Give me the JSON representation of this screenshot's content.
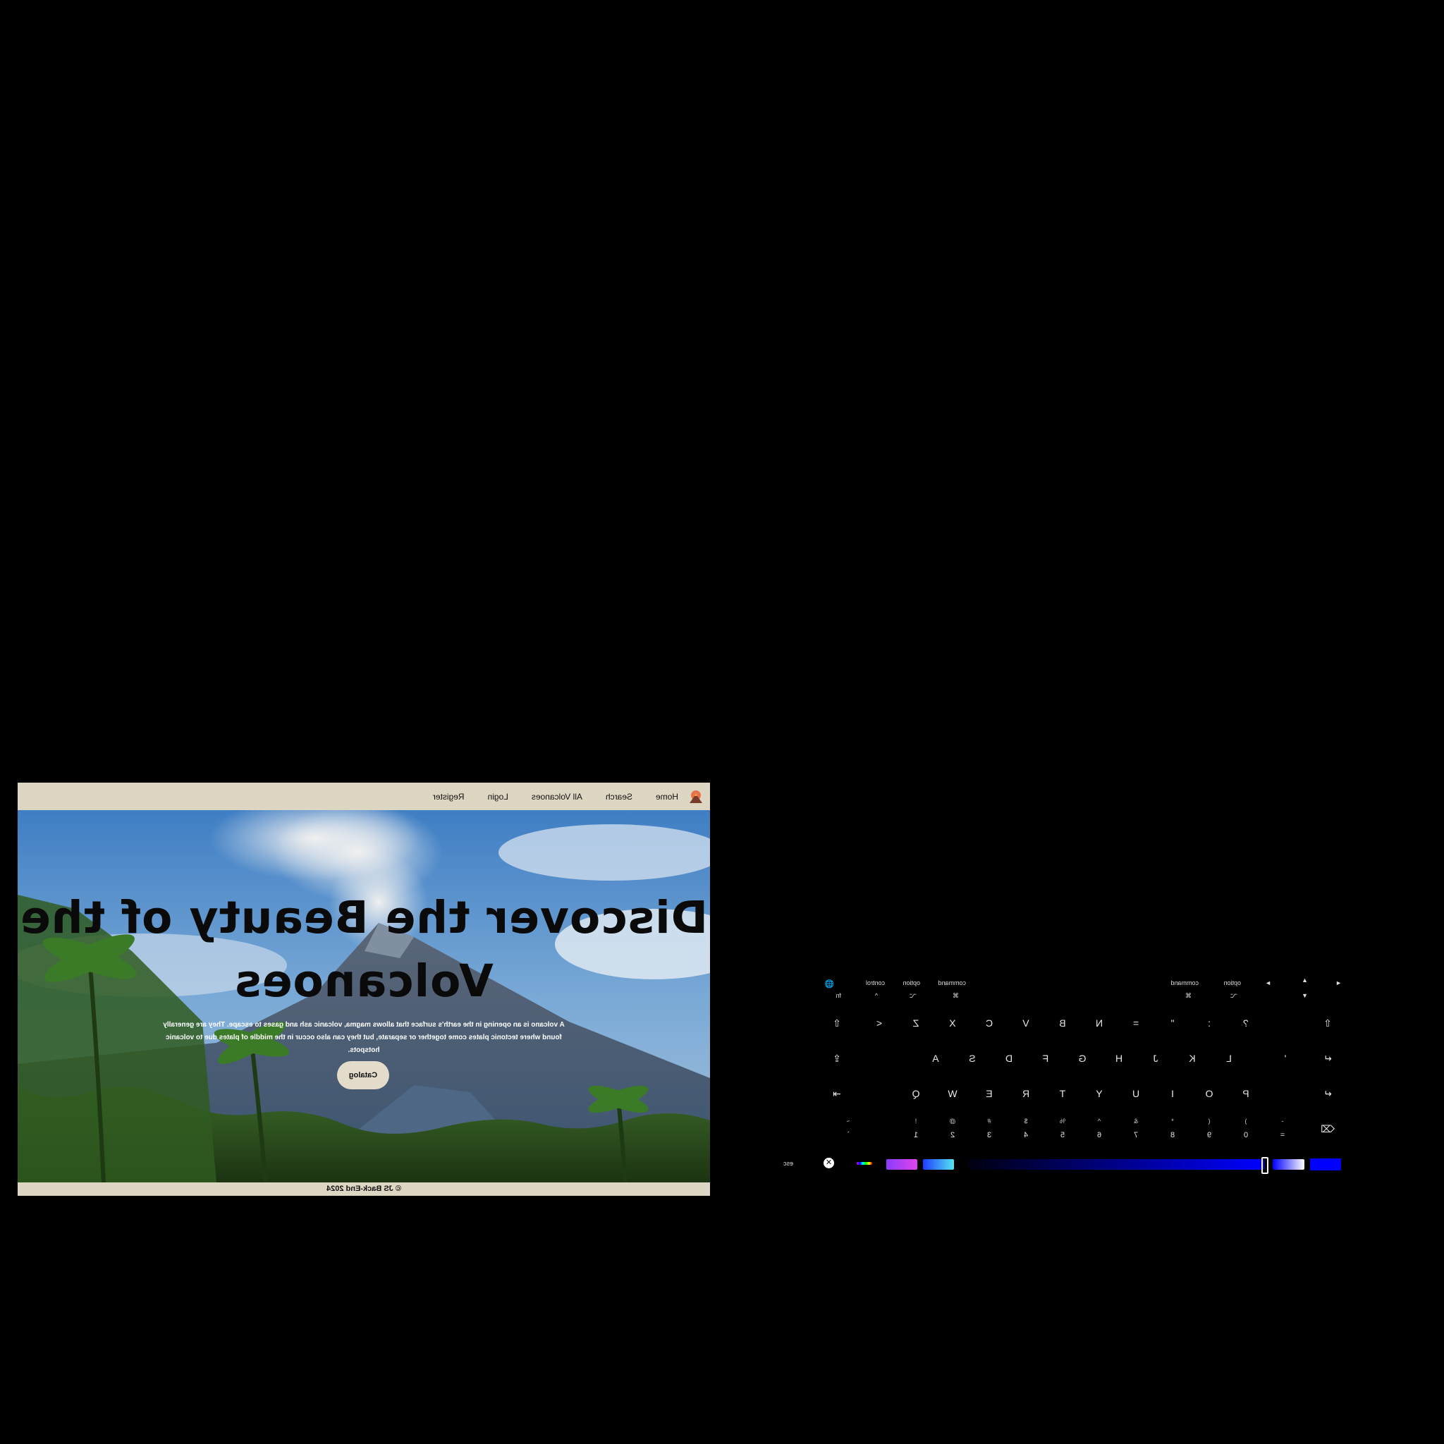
{
  "site": {
    "nav": {
      "items": [
        "Home",
        "Search",
        "All Volcanoes",
        "Login",
        "Register"
      ]
    },
    "hero": {
      "title": "Discover the Beauty of the Volcanoes",
      "description": "A volcano is an opening in the earth's surface that allows magma, volcanic ash and gases to escape. They are generally found where tectonic plates come together or separate, but they can also occur in the middle of plates due to volcanic hotspots.",
      "button": "Catalog"
    },
    "footer": "© JS Back-End 2024"
  },
  "keyboard": {
    "top_row": {
      "left": [
        "◄",
        "▲",
        "►",
        "▼"
      ],
      "modifiers_left": [
        "command",
        "option"
      ],
      "modifiers_right": [
        "command",
        "option",
        "control"
      ],
      "symbols_left": [
        "⌘",
        "⌥"
      ],
      "symbols_right": [
        "⌘",
        "⌥",
        "^",
        "fn"
      ],
      "globe": "🌐"
    },
    "row_z": [
      "⇧",
      "?",
      ":",
      "\"",
      "=",
      "N",
      "B",
      "V",
      "C",
      "X",
      "Z",
      "<",
      "⇧"
    ],
    "row_a": [
      "↵",
      "'",
      "L",
      "K",
      "J",
      "H",
      "G",
      "F",
      "D",
      "S",
      "A",
      "⇪"
    ],
    "row_q": [
      "↵",
      "P",
      "O",
      "I",
      "U",
      "Y",
      "T",
      "R",
      "E",
      "W",
      "Q",
      "⇥"
    ],
    "row_num": [
      "⌫",
      "-",
      ")",
      "(",
      "*",
      "&",
      "^",
      "%",
      "$",
      "#",
      "@",
      "!",
      "~"
    ],
    "row_num_lower": [
      "=",
      "0",
      "9",
      "8",
      "7",
      "6",
      "5",
      "4",
      "3",
      "2",
      "1",
      "`"
    ],
    "esc": "esc",
    "colors": {
      "accent": "#0000ff",
      "swatch1": "#e044e8",
      "swatch2": "#55e6f0"
    }
  }
}
